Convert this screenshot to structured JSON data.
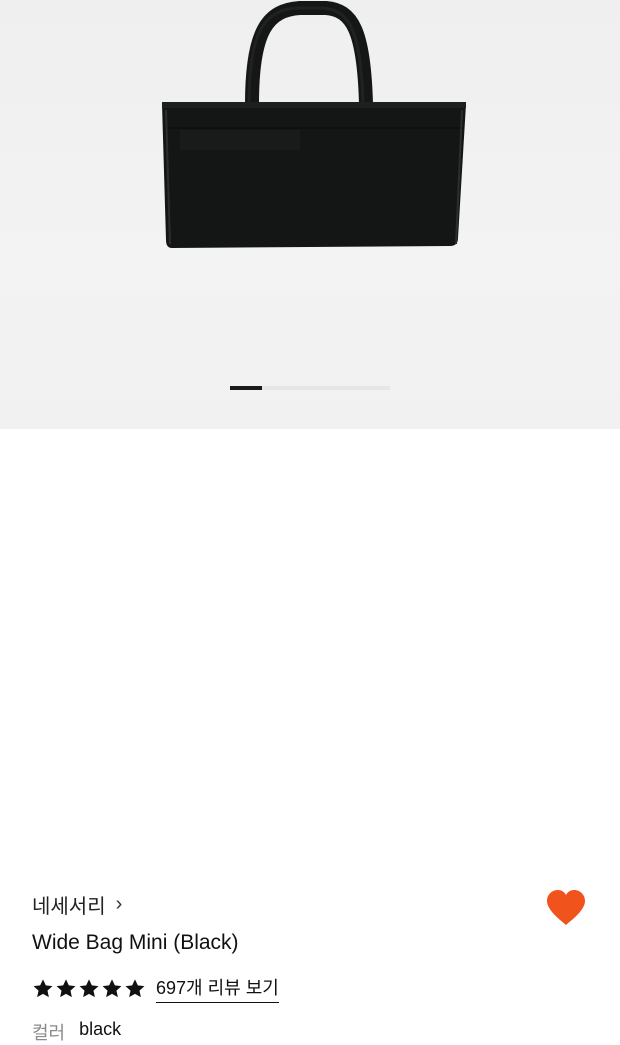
{
  "product_image": {
    "alt": "Wide Bag Mini (Black)",
    "carousel": {
      "current": 1,
      "position_fraction": 0.2
    }
  },
  "brand": {
    "name": "네세서리",
    "chevron": "›",
    "icon": "chevron-right-icon"
  },
  "wishlist": {
    "icon": "heart-icon",
    "active": true,
    "color": "#f0531c"
  },
  "product": {
    "title": "Wide Bag Mini (Black)"
  },
  "rating": {
    "stars": 5,
    "max": 5,
    "review_link": "697개 리뷰 보기"
  },
  "option": {
    "label": "컬러",
    "value": "black"
  }
}
